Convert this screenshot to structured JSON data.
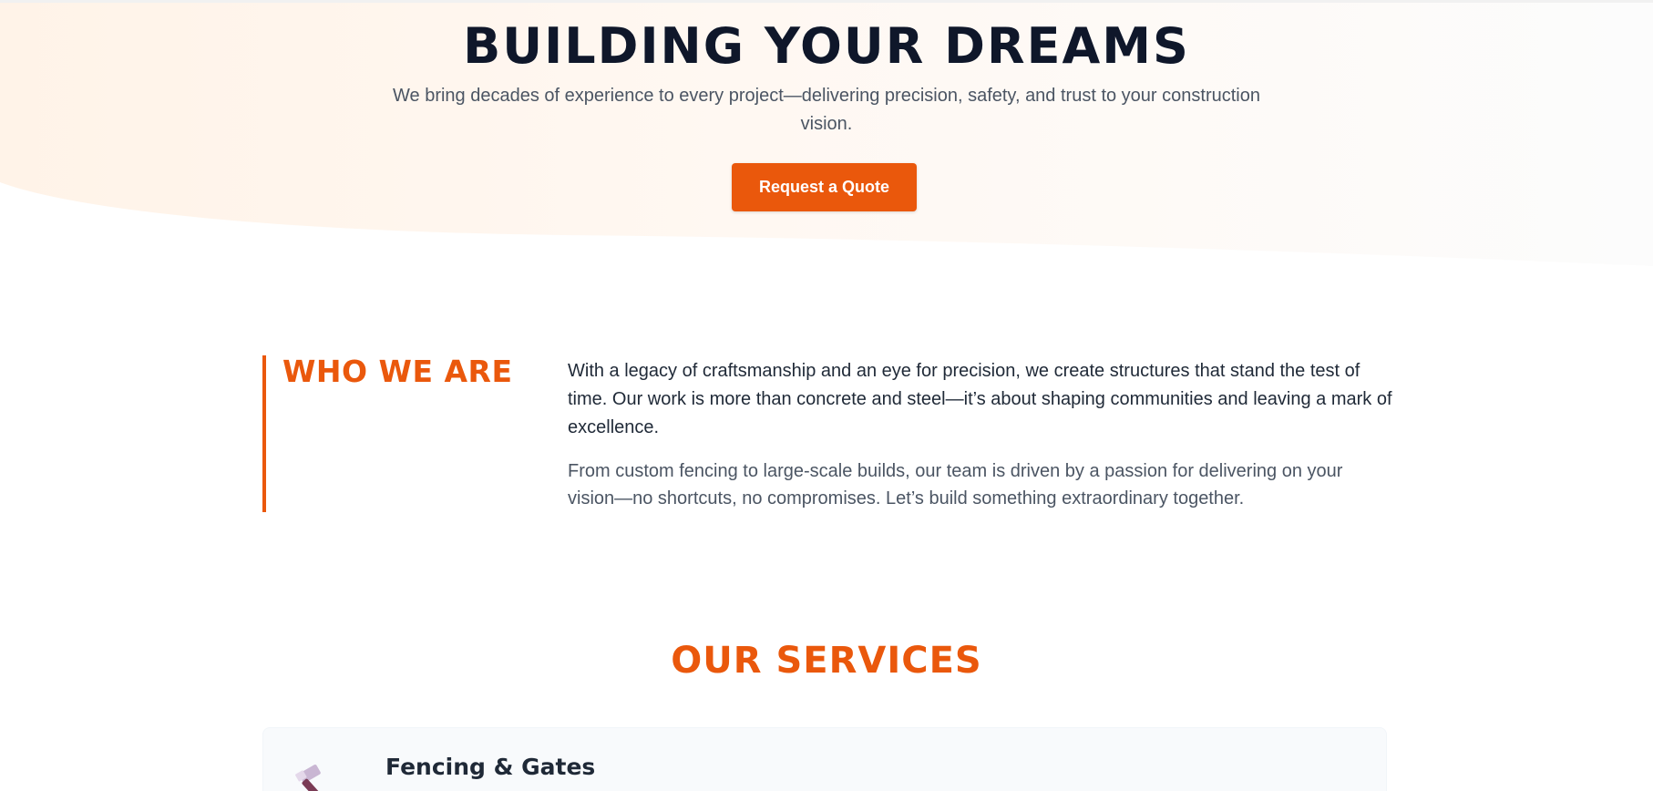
{
  "hero": {
    "title": "BUILDING YOUR DREAMS",
    "subtitle": "We bring decades of experience to every project—delivering precision, safety, and trust to your construction vision.",
    "cta_label": "Request a Quote"
  },
  "who": {
    "title": "WHO WE ARE",
    "paragraph1": "With a legacy of craftsmanship and an eye for precision, we create structures that stand the test of time. Our work is more than concrete and steel—it’s about shaping communities and leaving a mark of excellence.",
    "paragraph2": "From custom fencing to large-scale builds, our team is driven by a passion for delivering on your vision—no shortcuts, no compromises. Let’s build something extraordinary together."
  },
  "services": {
    "title": "OUR SERVICES",
    "items": [
      {
        "name": "Fencing & Gates",
        "icon": "hammer-icon"
      }
    ]
  },
  "colors": {
    "accent": "#ea580c",
    "heading": "#0f172a",
    "body_text": "#4b5563",
    "hero_tint": "#fff5ec",
    "card_bg": "#f8fafc"
  }
}
